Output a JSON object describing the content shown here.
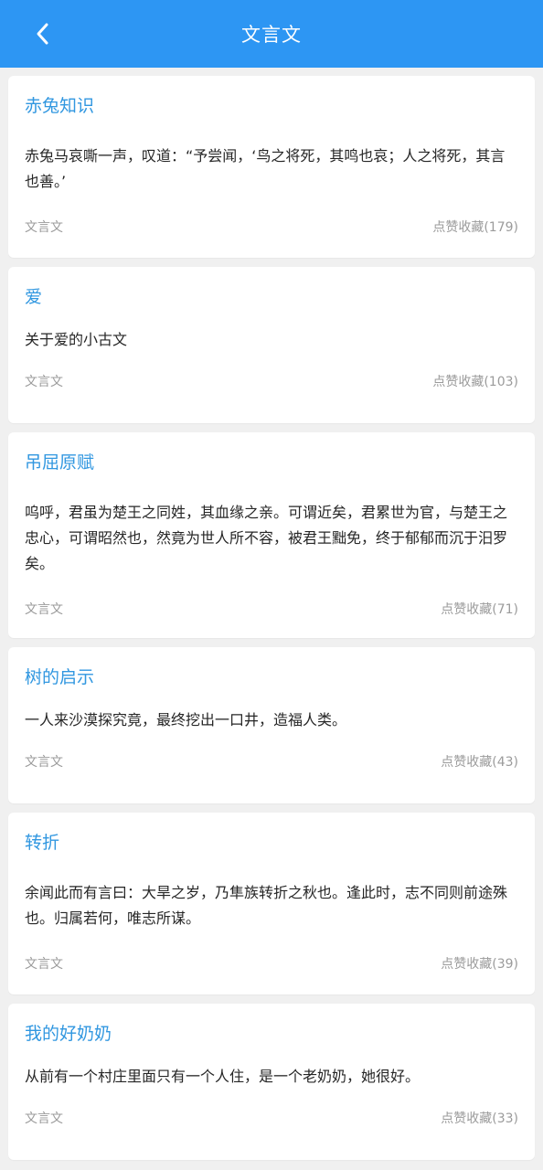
{
  "header": {
    "title": "文言文",
    "back_icon": "chevron-left-icon"
  },
  "colors": {
    "primary": "#2d96f3",
    "card_title": "#3197e0",
    "background": "#f0f0f0"
  },
  "cards": [
    {
      "title": "赤兔知识",
      "text": "赤兔马哀嘶一声，叹道：“予尝闻，‘鸟之将死，其鸣也哀；人之将死，其言也善。’",
      "category": "文言文",
      "likes": "点赞收藏(179)"
    },
    {
      "title": "爱",
      "text": "关于爱的小古文",
      "category": "文言文",
      "likes": "点赞收藏(103)"
    },
    {
      "title": "吊屈原赋",
      "text": "呜呼，君虽为楚王之同姓，其血缘之亲。可谓近矣，君累世为官，与楚王之忠心，可谓昭然也，然竟为世人所不容，被君王黜免，终于郁郁而沉于汨罗矣。",
      "category": "文言文",
      "likes": "点赞收藏(71)"
    },
    {
      "title": "树的启示",
      "text": "一人来沙漠探究竟，最终挖出一口井，造福人类。",
      "category": "文言文",
      "likes": "点赞收藏(43)"
    },
    {
      "title": "转折",
      "text": "余闻此而有言曰：大旱之岁，乃隼族转折之秋也。逢此时，志不同则前途殊也。归属若何，唯志所谋。",
      "category": "文言文",
      "likes": "点赞收藏(39)"
    },
    {
      "title": "我的好奶奶",
      "text": "从前有一个村庄里面只有一个人住，是一个老奶奶，她很好。",
      "category": "文言文",
      "likes": "点赞收藏(33)"
    }
  ]
}
